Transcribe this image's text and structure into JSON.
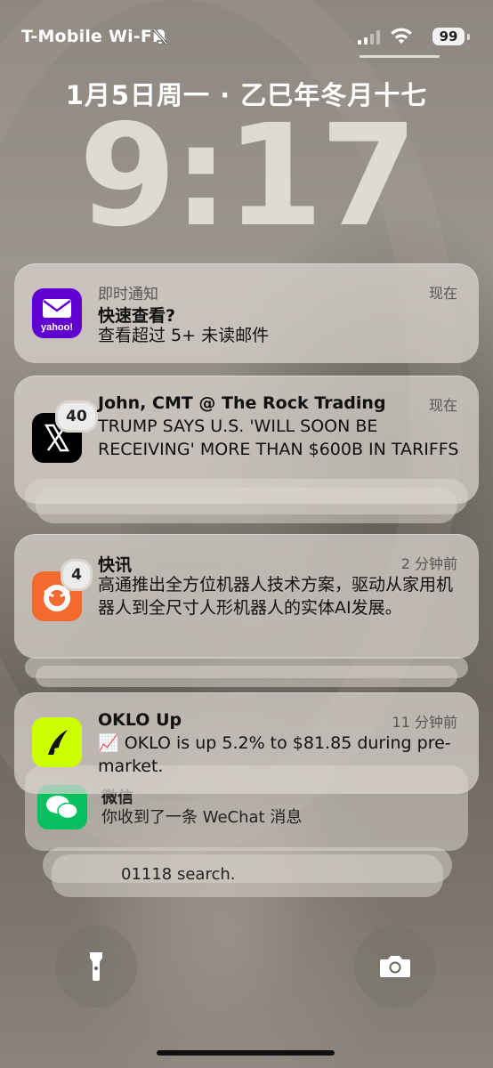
{
  "status_bar": {
    "carrier": "T-Mobile Wi-Fi",
    "battery": "99"
  },
  "lock": {
    "date": "1月5日周一 · 乙巳年冬月十七",
    "time": "9:17"
  },
  "notifications": [
    {
      "app": "即时通知",
      "title": "快速查看?",
      "body": "查看超过 5+ 未读邮件",
      "time": "现在",
      "icon": "yahoo-mail-icon",
      "icon_text": "yahoo!"
    },
    {
      "title": "John, CMT @ The Rock Trading",
      "body": "TRUMP SAYS U.S. 'WILL SOON BE RECEIVING' MORE THAN $600B IN TARIFFS",
      "time": "现在",
      "icon": "x-app-icon",
      "badge": "40"
    },
    {
      "title": "快讯",
      "body": "高通推出全方位机器人技术方案，驱动从家用机器人到全尺寸人形机器人的实体AI发展。",
      "time": "2 分钟前",
      "icon": "news-app-icon",
      "badge": "4"
    },
    {
      "title": "OKLO Up",
      "body": "📈 OKLO is up 5.2% to $81.85 during pre-market.",
      "time": "11 分钟前",
      "icon": "robinhood-icon"
    }
  ],
  "stacked": {
    "wechat_title": "微信",
    "wechat_body": "你收到了一条 WeChat 消息",
    "bottom_body": "01118 search."
  },
  "colors": {
    "yahoo": "#6001d2",
    "robinhood": "#ccff00",
    "wechat": "#07c160",
    "news": "#f26a2e"
  }
}
